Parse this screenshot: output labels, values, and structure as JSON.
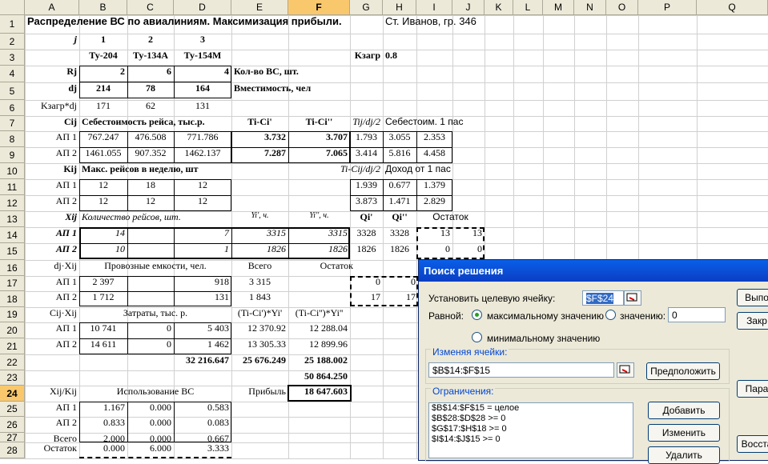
{
  "columns": [
    "A",
    "B",
    "C",
    "D",
    "E",
    "F",
    "G",
    "H",
    "I",
    "J",
    "K",
    "L",
    "M",
    "N",
    "O",
    "P",
    "Q"
  ],
  "rows": [
    "1",
    "2",
    "3",
    "4",
    "5",
    "6",
    "7",
    "8",
    "9",
    "10",
    "11",
    "12",
    "13",
    "14",
    "15",
    "16",
    "17",
    "18",
    "19",
    "20",
    "21",
    "22",
    "23",
    "24",
    "25",
    "26",
    "27",
    "28"
  ],
  "selected_col": "F",
  "selected_row": "24",
  "r1": {
    "title": "Распределение ВС по авиалиниям. Максимизация прибыли.",
    "author": "Ст. Иванов, гр. 346"
  },
  "r2": {
    "a": "j",
    "b": "1",
    "c": "2",
    "d": "3"
  },
  "r3": {
    "b": "Ту-204",
    "c": "Ту-134А",
    "d": "Ту-154М",
    "g": "Kзагр",
    "h": "0.8"
  },
  "r4": {
    "a": "Rj",
    "b": "2",
    "c": "6",
    "d": "4",
    "e": "Кол-во ВС, шт."
  },
  "r5": {
    "a": "dj",
    "b": "214",
    "c": "78",
    "d": "164",
    "e": "Вместимость, чел"
  },
  "r6": {
    "a": "Kзагр*dj",
    "b": "171",
    "c": "62",
    "d": "131"
  },
  "r7": {
    "a": "Cij",
    "b": "Себестоимость рейса, тыс.р.",
    "e": "Ti-Ci'",
    "f": "Ti-Ci''",
    "g": "Tij/dj/2",
    "h": "Себестоим. 1 пас"
  },
  "r8": {
    "a": "АП 1",
    "b": "767.247",
    "c": "476.508",
    "d": "771.786",
    "e": "3.732",
    "f": "3.707",
    "g": "1.793",
    "h": "3.055",
    "i": "2.353"
  },
  "r9": {
    "a": "АП 2",
    "b": "1461.055",
    "c": "907.352",
    "d": "1462.137",
    "e": "7.287",
    "f": "7.065",
    "g": "3.414",
    "h": "5.816",
    "i": "4.458"
  },
  "r10": {
    "a": "Kij",
    "b": "Макс. рейсов в неделю, шт",
    "f": "Ti-Cij/dj/2",
    "h": "Доход от 1 пас"
  },
  "r11": {
    "a": "АП 1",
    "b": "12",
    "c": "18",
    "d": "12",
    "g": "1.939",
    "h": "0.677",
    "i": "1.379"
  },
  "r12": {
    "a": "АП 2",
    "b": "12",
    "c": "12",
    "d": "12",
    "g": "3.873",
    "h": "1.471",
    "i": "2.829"
  },
  "r13": {
    "a": "Xij",
    "b": "Количество рейсов, шт.",
    "e": "Yi', ч.",
    "f": "Yi'', ч.",
    "g": "Qi'",
    "h": "Qi''",
    "i": "Остаток"
  },
  "r14": {
    "a": "АП 1",
    "b": "14",
    "d": "7",
    "e": "3315",
    "f": "3315",
    "g": "3328",
    "h": "3328",
    "i": "13",
    "j": "13"
  },
  "r15": {
    "a": "АП 2",
    "b": "10",
    "d": "1",
    "e": "1826",
    "f": "1826",
    "g": "1826",
    "h": "1826",
    "i": "0",
    "j": "0"
  },
  "r16": {
    "a": "dj·Xij",
    "b": "Провозные емкости, чел.",
    "e": "Всего",
    "f": "Остаток"
  },
  "r17": {
    "a": "АП 1",
    "b": "2 397",
    "d": "918",
    "e": "3 315",
    "g": "0",
    "h": "0"
  },
  "r18": {
    "a": "АП 2",
    "b": "1 712",
    "d": "131",
    "e": "1 843",
    "g": "17",
    "h": "17"
  },
  "r19": {
    "a": "Cij·Xij",
    "b": "Затраты, тыс. р.",
    "e": "(Ti-Ci')*Yi'",
    "f": "(Ti-Ci'')*Yi''"
  },
  "r20": {
    "a": "АП 1",
    "b": "10 741",
    "c": "0",
    "d": "5 403",
    "e": "12 370.92",
    "f": "12 288.04"
  },
  "r21": {
    "a": "АП 2",
    "b": "14 611",
    "c": "0",
    "d": "1 462",
    "e": "13 305.33",
    "f": "12 899.96"
  },
  "r22": {
    "d": "32 216.647",
    "e": "25 676.249",
    "f": "25 188.002"
  },
  "r23": {
    "f": "50 864.250"
  },
  "r24": {
    "a": "Xij/Kij",
    "b": "Использование ВС",
    "e": "Прибыль",
    "f": "18 647.603"
  },
  "r25": {
    "a": "АП 1",
    "b": "1.167",
    "c": "0.000",
    "d": "0.583"
  },
  "r26": {
    "a": "АП 2",
    "b": "0.833",
    "c": "0.000",
    "d": "0.083"
  },
  "r27": {
    "a": "Всего",
    "b": "2.000",
    "c": "0.000",
    "d": "0.667"
  },
  "r28": {
    "a": "Остаток",
    "b": "0.000",
    "c": "6.000",
    "d": "3.333"
  },
  "solver": {
    "title": "Поиск решения",
    "target_label": "Установить целевую ячейку:",
    "target_value": "$F$24",
    "equal_label": "Равной:",
    "max_label": "максимальному значению",
    "value_label": "значению:",
    "value_input": "0",
    "min_label": "минимальному значению",
    "changing_label": "Изменяя ячейки:",
    "changing_value": "$B$14:$F$15",
    "guess_button": "Предположить",
    "constraints_label": "Ограничения:",
    "constraints": [
      "$B$14:$F$15 = целое",
      "$B$28:$D$28 >= 0",
      "$G$17:$H$18 >= 0",
      "$I$14:$J$15 >= 0"
    ],
    "add_button": "Добавить",
    "change_button": "Изменить",
    "delete_button": "Удалить",
    "run_button": "Выпо",
    "close_button": "Закр",
    "params_button": "Пара",
    "restore_button": "Восста"
  }
}
